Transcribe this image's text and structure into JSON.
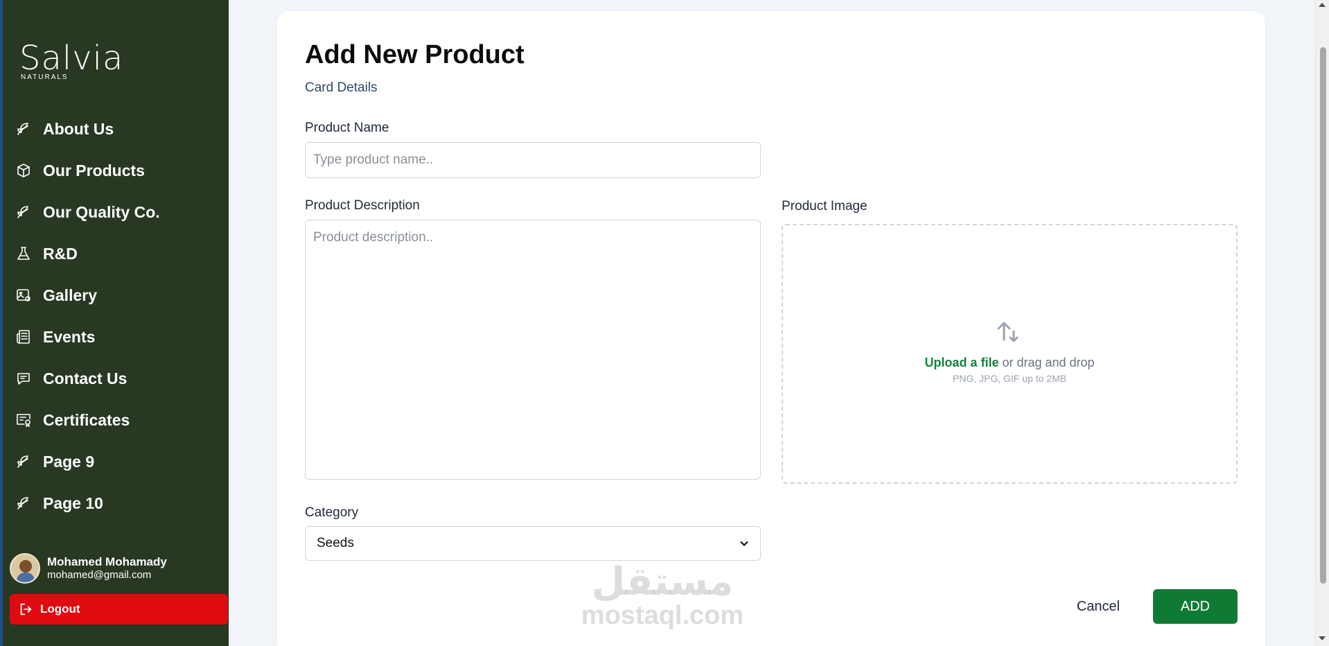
{
  "brand": {
    "name": "Salvia",
    "tagline": "NATURALS"
  },
  "sidebar": {
    "items": [
      {
        "label": "About Us",
        "icon": "leaf-icon"
      },
      {
        "label": "Our Products",
        "icon": "box-icon"
      },
      {
        "label": "Our Quality Co.",
        "icon": "leaf-icon"
      },
      {
        "label": "R&D",
        "icon": "flask-icon"
      },
      {
        "label": "Gallery",
        "icon": "gallery-icon"
      },
      {
        "label": "Events",
        "icon": "newspaper-icon"
      },
      {
        "label": "Contact Us",
        "icon": "chat-icon"
      },
      {
        "label": "Certificates",
        "icon": "certificate-icon"
      },
      {
        "label": "Page 9",
        "icon": "leaf-icon"
      },
      {
        "label": "Page 10",
        "icon": "leaf-icon"
      }
    ]
  },
  "user": {
    "name": "Mohamed Mohamady",
    "email": "mohamed@gmail.com"
  },
  "logout": {
    "label": "Logout"
  },
  "form": {
    "title": "Add New Product",
    "subtitle": "Card Details",
    "product_name": {
      "label": "Product Name",
      "placeholder": "Type product name..",
      "value": ""
    },
    "product_description": {
      "label": "Product Description",
      "placeholder": "Product description..",
      "value": ""
    },
    "product_image": {
      "label": "Product Image",
      "upload_link": "Upload a file",
      "upload_text": " or drag and drop",
      "hint": "PNG, JPG, GIF up to 2MB"
    },
    "category": {
      "label": "Category",
      "selected": "Seeds"
    },
    "cancel_label": "Cancel",
    "add_label": "ADD"
  },
  "watermark": {
    "arabic": "مستقل",
    "latin": "mostaql.com"
  },
  "colors": {
    "sidebar_bg": "#283823",
    "accent_green": "#0f7a33",
    "logout_red": "#e00b10",
    "link_green": "#16803c"
  }
}
